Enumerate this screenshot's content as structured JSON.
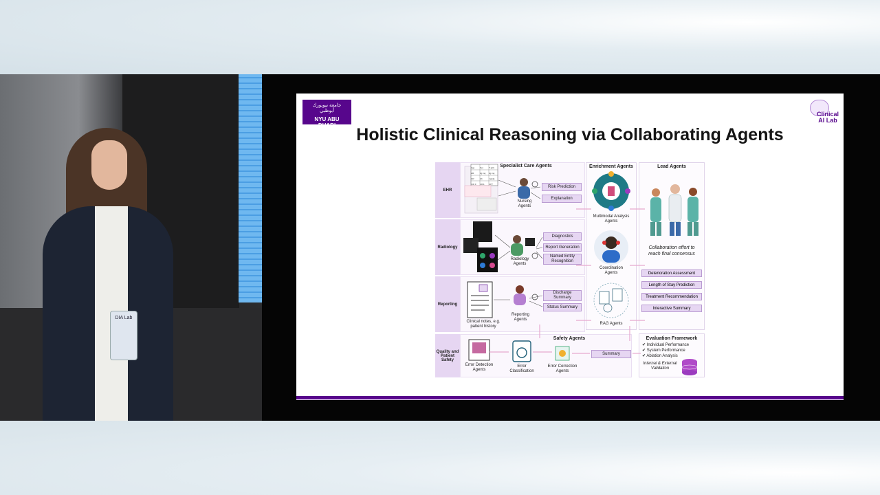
{
  "slide": {
    "title": "Holistic Clinical Reasoning via Collaborating Agents",
    "nyu_logo_arabic": "جامعة نيويورك أبوظبي",
    "nyu_logo_text": "NYU ABU DHABI",
    "lab_logo_text": "Clinical AI Lab"
  },
  "presenter_badge": "DIA Lab",
  "diagram": {
    "columns": {
      "specialist": "Specialist Care Agents",
      "enrichment": "Enrichment Agents",
      "lead": "Lead Agents"
    },
    "rows": [
      {
        "label": "EHR",
        "agent": "Nursing Agents",
        "outputs": [
          "Risk Prediction",
          "Explanation"
        ]
      },
      {
        "label": "Radiology",
        "agent": "Radiology Agents",
        "outputs": [
          "Diagnostics",
          "Report Generation",
          "Named Entity Recognition"
        ]
      },
      {
        "label": "Reporting",
        "agent": "Reporting Agents",
        "source": "Clinical notes, e.g. patient history",
        "outputs": [
          "Discharge Summary",
          "Status Summary"
        ]
      }
    ],
    "enrichment_agents": [
      "Multimodal Analysis Agents",
      "Coordination Agents",
      "RAG Agents"
    ],
    "lead": {
      "consensus": "Collaboration effort to reach final consensus",
      "outputs": [
        "Deterioration Assessment",
        "Length of Stay Prediction",
        "Treatment Recommendation",
        "Interactive Summary"
      ]
    },
    "safety": {
      "label": "Quality and Patient Safety",
      "header": "Safety Agents",
      "agents": [
        "Error Detection Agents",
        "Error Classification",
        "Error Correction Agents"
      ],
      "output": "Summary"
    },
    "evaluation": {
      "header": "Evaluation Framework",
      "items": [
        "Individual Performance",
        "System Performance",
        "Ablation Analysis"
      ],
      "validation": "Internal & External Validation"
    },
    "ehr_table": [
      "Age",
      "Sex",
      "T (g/l)",
      "HR",
      "bg mg",
      "bg mg",
      "GR",
      "Hb",
      "mg/dg",
      "ICD F",
      "CDS",
      "CP?"
    ]
  },
  "colors": {
    "brand_purple": "#57068c",
    "tag_fill": "#e6d6f2",
    "arrow_pink": "#e7a9cf"
  }
}
